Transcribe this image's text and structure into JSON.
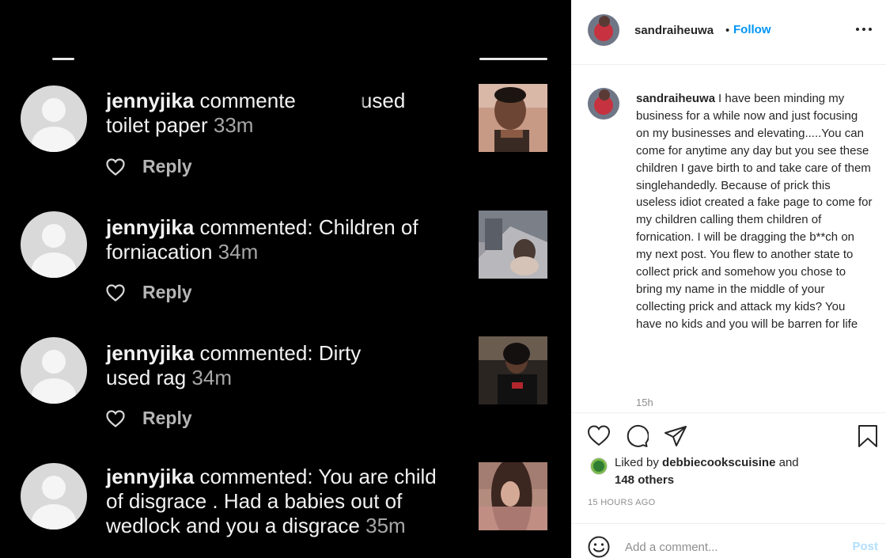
{
  "comments_screenshot": {
    "reply_label": "Reply",
    "comments": [
      {
        "user": "jennyjika",
        "verb": "commented:",
        "line1_visible": "commente",
        "line1_tail": "used",
        "line2": "toilet paper",
        "time": "33m"
      },
      {
        "user": "jennyjika",
        "verb": "commented:",
        "line1_tail": "Children of",
        "line2": "forniacation",
        "time": "34m"
      },
      {
        "user": "jennyjika",
        "verb": "commented:",
        "line1_tail": "Dirty",
        "line2": "used rag",
        "time": "34m"
      },
      {
        "user": "jennyjika",
        "verb": "commented:",
        "line1_tail": "You are child",
        "line2": "of disgrace . Had a babies out of",
        "line3": "wedlock and you a disgrace",
        "time": "35m"
      }
    ]
  },
  "post": {
    "header": {
      "username": "sandraiheuwa",
      "separator": "•",
      "follow_label": "Follow"
    },
    "caption": {
      "username": "sandraiheuwa",
      "text": "I have been minding my business for a while now and just focusing on my businesses and elevating.....You can come for anytime any day but you see these children I gave birth to and take care of them singlehandedly. Because of prick this useless idiot created a fake page to come for my children calling them children of fornication. I will be dragging the b**ch on my next post. You flew to another state to collect prick and somehow you chose to bring my name in the middle of your collecting prick and attack my kids? You have no kids and you will be barren for life",
      "time": "15h"
    },
    "likes": {
      "prefix": "Liked by",
      "liker": "debbiecookscuisine",
      "and": "and",
      "others": "148 others"
    },
    "timestamp": "15 HOURS AGO",
    "comment_box": {
      "placeholder": "Add a comment...",
      "post_label": "Post"
    },
    "icons": [
      "heart-icon",
      "comment-icon",
      "share-icon",
      "bookmark-icon",
      "emoji-icon",
      "more-options-icon"
    ],
    "colors": {
      "accent": "#0095f6",
      "post_disabled": "#b2dffc",
      "muted": "#8e8e8e",
      "text": "#262626",
      "media_bg": "#000000"
    }
  }
}
